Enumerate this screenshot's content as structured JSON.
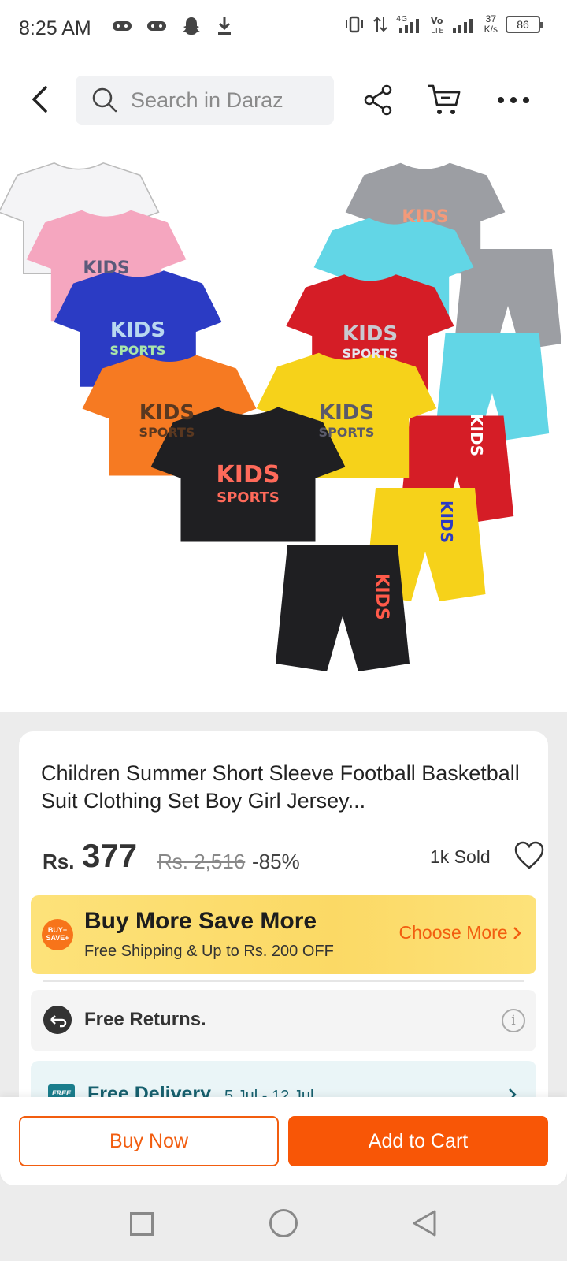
{
  "status_bar": {
    "time": "8:25 AM",
    "net_speed_value": "37",
    "net_speed_unit": "K/s",
    "battery": "86"
  },
  "header": {
    "search_placeholder": "Search in Daraz"
  },
  "product": {
    "title": "Children Summer Short Sleeve Football Basketball Suit Clothing Set Boy Girl Jersey...",
    "currency": "Rs.",
    "price": "377",
    "original_price": "Rs. 2,516",
    "discount": "-85%",
    "sold": "1k Sold"
  },
  "promo": {
    "badge_top": "BUY+",
    "badge_bottom": "SAVE+",
    "title": "Buy More Save More",
    "subtitle": "Free Shipping & Up to Rs. 200 OFF",
    "link": "Choose More"
  },
  "returns": {
    "label": "Free Returns."
  },
  "delivery": {
    "badge": "FREE",
    "label": "Free Delivery",
    "date": "5 Jul - 12 Jul"
  },
  "actions": {
    "buy_now": "Buy Now",
    "add_to_cart": "Add to Cart"
  },
  "image": {
    "shirt_text_top": "KIDS",
    "shirt_text_bottom": "SPORTS",
    "shorts_text": "KIDS",
    "colors": [
      "#f4f4f6",
      "#f5a6bf",
      "#2b3bc4",
      "#f67a22",
      "#1f1f22",
      "#9c9ea3",
      "#62d6e6",
      "#d51d26",
      "#f6d21a"
    ]
  },
  "colors": {
    "accent": "#f85606",
    "promo_bg": "#fbd965"
  }
}
